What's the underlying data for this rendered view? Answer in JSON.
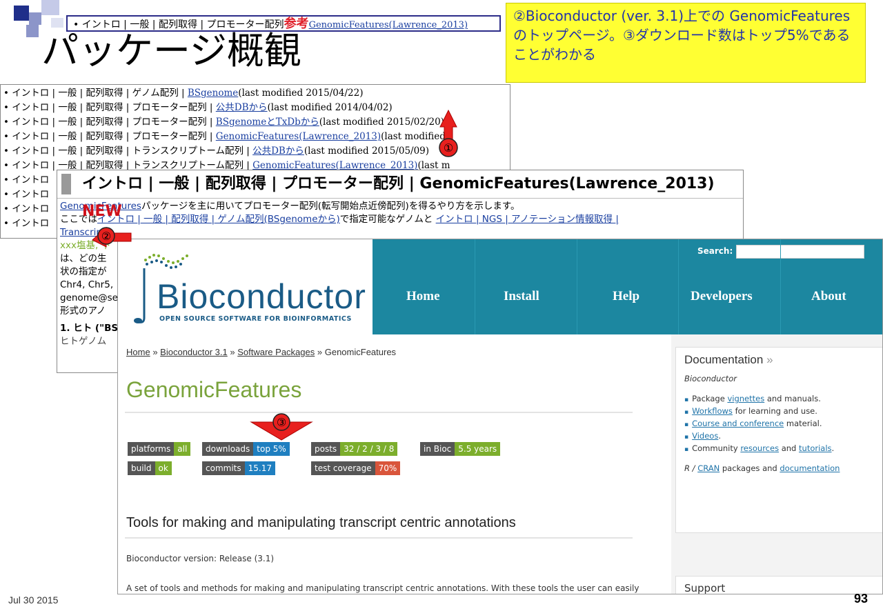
{
  "slide": {
    "top_bullet": {
      "prefix": "• イントロ | 一般 | 配列取得 | プロモーター配列",
      "ref": "参考",
      "link": "GenomicFeatures(Lawrence_2013)"
    },
    "title": "パッケージ概観",
    "callout": {
      "text": "②Bioconductor (ver. 3.1)上での GenomicFeaturesのトップページ。③ダウンロード数はトップ5%であることがわかる"
    },
    "date": "Jul 30 2015",
    "page_number": "93"
  },
  "doc_list": {
    "items": [
      {
        "text": "• イントロ | 一般 | 配列取得 | ゲノム配列 | ",
        "link": "BSgenome",
        "mod": "(last modified 2015/04/22)"
      },
      {
        "text": "• イントロ | 一般 | 配列取得 | プロモーター配列 | ",
        "link": "公共DBから",
        "mod": "(last modified 2014/04/02)"
      },
      {
        "text": "• イントロ | 一般 | 配列取得 | プロモーター配列 | ",
        "link": "BSgenomeとTxDbから",
        "mod": "(last modified 2015/02/20)"
      },
      {
        "text": "• イントロ | 一般 | 配列取得 | プロモーター配列 | ",
        "link": "GenomicFeatures(Lawrence_2013)",
        "mod": "(last modified"
      },
      {
        "text": "• イントロ | 一般 | 配列取得 | トランスクリプトーム配列 | ",
        "link": "公共DBから",
        "mod": "(last modified 2015/05/09)"
      },
      {
        "text": "• イントロ | 一般 | 配列取得 | トランスクリプトーム配列 | ",
        "link": "GenomicFeatures(Lawrence_2013)",
        "mod": "(last m"
      },
      {
        "text": "• イントロ",
        "link": "",
        "mod": ""
      },
      {
        "text": "• イントロ",
        "link": "",
        "mod": ""
      },
      {
        "text": "• イントロ",
        "link": "",
        "mod": ""
      },
      {
        "text": "• イントロ",
        "link": "",
        "mod": ""
      }
    ]
  },
  "panel": {
    "heading": "イントロ | 一般 | 配列取得 | プロモーター配列 | GenomicFeatures(Lawrence_2013)",
    "new": "NEW",
    "line1_link": "GenomicFeatures",
    "line1_text": "パッケージを主に用いてプロモーター配列(転写開始点近傍配列)を得るやり方を示します。",
    "line2_pre": "ここでは",
    "line2_link": "イントロ | 一般 | 配列取得 | ゲノム配列(BSgenomeから)",
    "line2_mid": "で指定可能なゲノムと ",
    "line2_link2": "イントロ | NGS | アノテーション情報取得 |",
    "line3_link": "Transcript",
    "side_lines": [
      "xxx塩基, 下",
      "は、どの生",
      "状の指定が",
      "Chr4, Chr5,",
      "genome@se",
      "形式のアノ"
    ],
    "sub_heading": "1. ヒト (\"BS",
    "sub_line": "ヒトゲノム"
  },
  "bioc": {
    "logo_text": "Bioconductor",
    "logo_sub": "OPEN SOURCE SOFTWARE FOR BIOINFORMATICS",
    "search_label": "Search:",
    "search_placeholder": "",
    "nav": [
      "Home",
      "Install",
      "Help",
      "Developers",
      "About"
    ],
    "breadcrumb": [
      "Home",
      "Bioconductor 3.1",
      "Software Packages",
      "GenomicFeatures"
    ],
    "breadcrumb_sep": "»",
    "package_title": "GenomicFeatures",
    "badges": [
      {
        "label": "platforms",
        "value": "all",
        "color": "#7cae2c"
      },
      {
        "label": "downloads",
        "value": "top 5%",
        "color": "#1f7fc0"
      },
      {
        "label": "posts",
        "value": "32 / 2 / 3 / 8",
        "color": "#7cae2c"
      },
      {
        "label": "in Bioc",
        "value": "5.5 years",
        "color": "#7cae2c"
      },
      {
        "label": "build",
        "value": "ok",
        "color": "#7cae2c"
      },
      {
        "label": "commits",
        "value": "15.17",
        "color": "#1f7fc0"
      },
      {
        "label": "test coverage",
        "value": "70%",
        "color": "#d9553b"
      }
    ],
    "desc_heading": "Tools for making and manipulating transcript centric annotations",
    "version": "Bioconductor version: Release (3.1)",
    "description": "A set of tools and methods for making and manipulating transcript centric annotations. With these tools the user can easily download the genomic locations of the transcripts, exons and cds of a given organism",
    "sidebar": {
      "doc_heading": "Documentation",
      "doc_arrow": "»",
      "doc_sub": "Bioconductor",
      "items": [
        {
          "pre": "Package ",
          "link": "vignettes",
          "post": " and manuals."
        },
        {
          "pre": "",
          "link": "Workflows",
          "post": " for learning and use."
        },
        {
          "pre": "",
          "link": "Course and conference",
          "post": " material."
        },
        {
          "pre": "",
          "link": "Videos",
          "post": "."
        },
        {
          "pre": "Community ",
          "link": "resources",
          "post": " and ",
          "link2": "tutorials",
          "post2": "."
        }
      ],
      "r_pre": "R / ",
      "r_link": "CRAN",
      "r_mid": " packages and ",
      "r_link2": "documentation",
      "support_heading": "Support"
    }
  },
  "markers": [
    "①",
    "②",
    "③"
  ],
  "colors": {
    "marker_red": "#e8201e",
    "nav_teal": "#1c87a0",
    "callout_yellow": "#ffff33",
    "callout_text": "#2233aa"
  }
}
